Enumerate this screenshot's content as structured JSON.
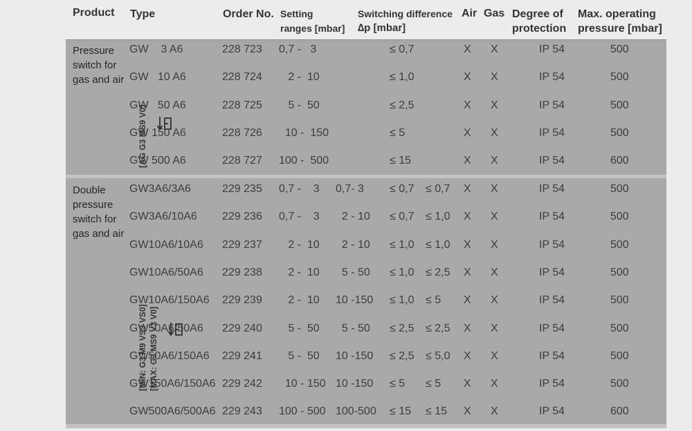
{
  "header": {
    "product": "Product",
    "type": "Type",
    "order_no": "Order No.",
    "setting_line1": "Setting",
    "setting_line2": "ranges [mbar]",
    "switching_line1": "Switching  difference",
    "switching_line2": "∆p [mbar]",
    "air": "Air",
    "gas": "Gas",
    "protection_line1": "Degree of",
    "protection_line2": "protection",
    "max_line1": "Max. operating",
    "max_line2": "pressure [mbar]"
  },
  "group1": {
    "product_lines": [
      "Pressure",
      "switch for",
      "gas and air"
    ],
    "code": "[AG G3 MS9 V0]",
    "rows": [
      {
        "type": "GW    3 A6",
        "order": "228 723",
        "setting": "0,7 -   3",
        "setting2": "",
        "diff": "≤ 0,7",
        "diff2": "",
        "air": "X",
        "gas": "X",
        "protection": "IP 54",
        "max": "500"
      },
      {
        "type": "GW   10 A6",
        "order": "228 724",
        "setting": "   2 -  10",
        "setting2": "",
        "diff": "≤ 1,0",
        "diff2": "",
        "air": "X",
        "gas": "X",
        "protection": "IP 54",
        "max": "500"
      },
      {
        "type": "GW   50 A6",
        "order": "228 725",
        "setting": "   5 -  50",
        "setting2": "",
        "diff": "≤ 2,5",
        "diff2": "",
        "air": "X",
        "gas": "X",
        "protection": "IP 54",
        "max": "500"
      },
      {
        "type": "GW 150 A6",
        "order": "228 726",
        "setting": "  10 -  150",
        "setting2": "",
        "diff": "≤ 5",
        "diff2": "",
        "air": "X",
        "gas": "X",
        "protection": "IP 54",
        "max": "500"
      },
      {
        "type": "GW 500 A6",
        "order": "228 727",
        "setting": "100 -  500",
        "setting2": "",
        "diff": "≤ 15",
        "diff2": "",
        "air": "X",
        "gas": "X",
        "protection": "IP 54",
        "max": "600"
      }
    ]
  },
  "group2": {
    "product_lines": [
      "Double",
      "pressure",
      "switch for",
      "gas and air"
    ],
    "code_min": "[MIN: G3 M9 VS3 VS0]",
    "code_max": "[MAX: G3 MS9 V3 V0]",
    "rows": [
      {
        "type": "GW3A6/3A6",
        "order": "229 235",
        "setting": "0,7 -    3",
        "setting2": "0,7- 3",
        "diff": "≤ 0,7",
        "diff2": "≤ 0,7",
        "air": "X",
        "gas": "X",
        "protection": "IP 54",
        "max": "500"
      },
      {
        "type": "GW3A6/10A6",
        "order": "229 236",
        "setting": "0,7 -    3",
        "setting2": "  2 - 10",
        "diff": "≤ 0,7",
        "diff2": "≤ 1,0",
        "air": "X",
        "gas": "X",
        "protection": "IP 54",
        "max": "500"
      },
      {
        "type": "GW10A6/10A6",
        "order": "229 237",
        "setting": "   2 -  10",
        "setting2": "  2 - 10",
        "diff": "≤ 1,0",
        "diff2": "≤ 1,0",
        "air": "X",
        "gas": "X",
        "protection": "IP 54",
        "max": "500"
      },
      {
        "type": "GW10A6/50A6",
        "order": "229 238",
        "setting": "   2 -  10",
        "setting2": "  5 - 50",
        "diff": "≤ 1,0",
        "diff2": "≤ 2,5",
        "air": "X",
        "gas": "X",
        "protection": "IP 54",
        "max": "500"
      },
      {
        "type": "GW10A6/150A6",
        "order": "229 239",
        "setting": "   2 -  10",
        "setting2": "10 -150",
        "diff": "≤ 1,0",
        "diff2": "≤ 5",
        "air": "X",
        "gas": "X",
        "protection": "IP 54",
        "max": "500"
      },
      {
        "type": "GW50A6/50A6",
        "order": "229 240",
        "setting": "   5 -  50",
        "setting2": "  5 - 50",
        "diff": "≤ 2,5",
        "diff2": "≤ 2,5",
        "air": "X",
        "gas": "X",
        "protection": "IP 54",
        "max": "500"
      },
      {
        "type": "GW50A6/150A6",
        "order": "229 241",
        "setting": "   5 -  50",
        "setting2": "10 -150",
        "diff": "≤ 2,5",
        "diff2": "≤ 5,0",
        "air": "X",
        "gas": "X",
        "protection": "IP 54",
        "max": "500"
      },
      {
        "type": "GW150A6/150A6",
        "order": "229 242",
        "setting": "  10 - 150",
        "setting2": "10 -150",
        "diff": "≤ 5",
        "diff2": "≤ 5",
        "air": "X",
        "gas": "X",
        "protection": "IP 54",
        "max": "500"
      },
      {
        "type": "GW500A6/500A6",
        "order": "229 243",
        "setting": "100 - 500",
        "setting2": "100-500",
        "diff": "≤ 15",
        "diff2": "≤ 15",
        "air": "X",
        "gas": "X",
        "protection": "IP 54",
        "max": "600"
      }
    ]
  }
}
